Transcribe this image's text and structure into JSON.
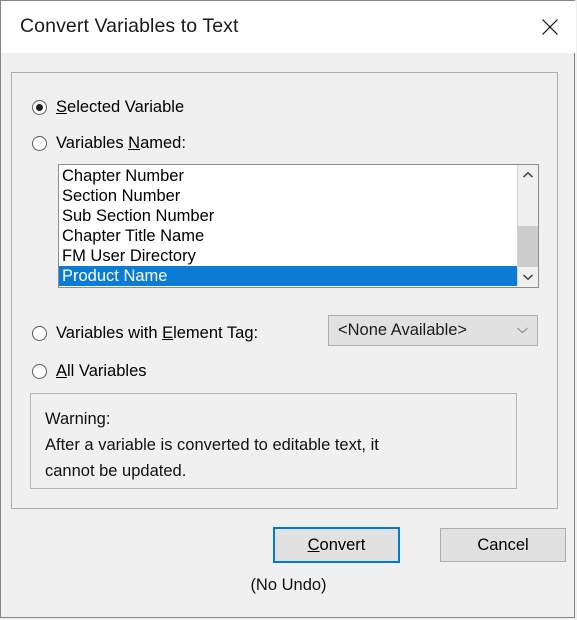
{
  "dialog": {
    "title": "Convert Variables to Text",
    "close_icon": "close-icon",
    "accent_color": "#0078d7",
    "selection_color": "#0a7cd5",
    "background_color": "#f0f0f0"
  },
  "options": {
    "selected_variable": {
      "label_before": "S",
      "mnemonic": "S",
      "label": "Selected Variable",
      "label_prefix": "",
      "label_rest": "elected Variable",
      "checked": true
    },
    "variables_named": {
      "label": "Variables Named:",
      "label_prefix": "Variables ",
      "mnemonic": "N",
      "label_rest": "amed:",
      "checked": false
    },
    "variables_with_element_tag": {
      "label": "Variables with Element Tag:",
      "label_prefix": "Variables with ",
      "mnemonic": "E",
      "label_rest": "lement Tag:",
      "checked": false
    },
    "all_variables": {
      "label": "All Variables",
      "label_prefix": "",
      "mnemonic": "A",
      "label_rest": "ll Variables",
      "checked": false
    }
  },
  "variable_list": {
    "items": [
      "Chapter Number",
      "Section Number",
      "Sub Section Number",
      "Chapter Title Name",
      "FM User Directory",
      "Product Name"
    ],
    "selected_index": 5,
    "selected_value": "Product Name",
    "scrollbar": {
      "up_icon": "chevron-up-icon",
      "down_icon": "chevron-down-icon",
      "thumb_color": "#cdcdcd"
    }
  },
  "element_tag_dropdown": {
    "selected_value": "<None Available>",
    "chevron_icon": "chevron-down-icon",
    "disabled": true
  },
  "warning": {
    "heading": "Warning:",
    "line1": "After a variable is converted to editable text, it",
    "line2": "cannot be updated."
  },
  "buttons": {
    "convert": {
      "label": "Convert",
      "label_prefix": "",
      "mnemonic": "C",
      "label_rest": "onvert",
      "focused": true
    },
    "cancel": {
      "label": "Cancel"
    }
  },
  "footer": {
    "no_undo": "(No Undo)"
  }
}
